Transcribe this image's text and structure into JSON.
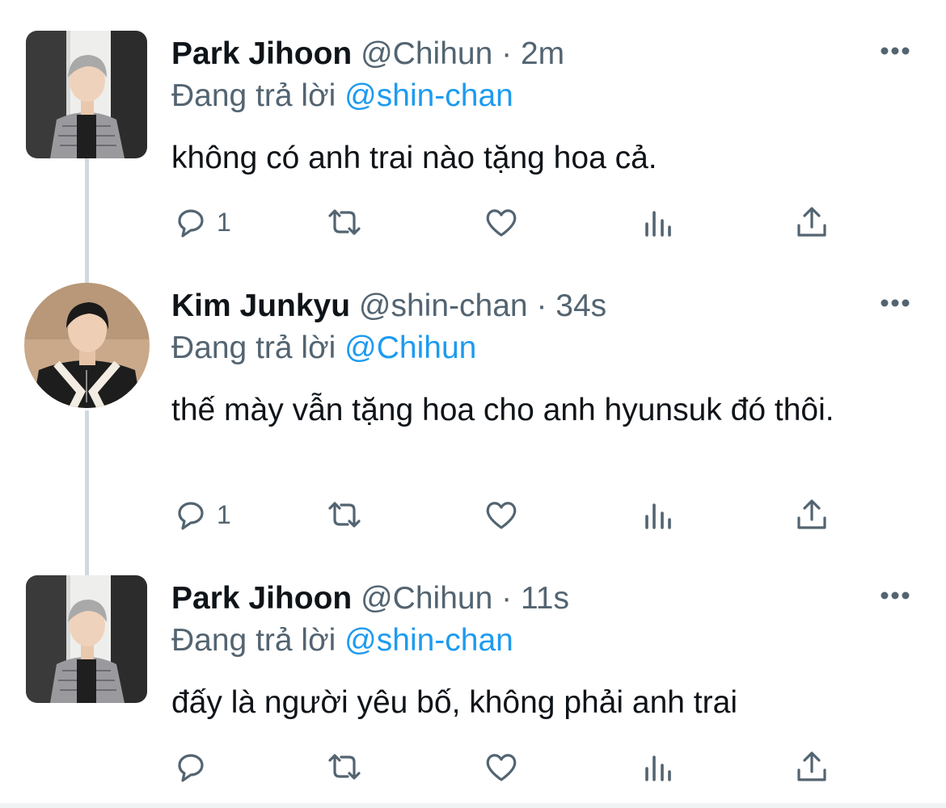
{
  "tweets": [
    {
      "name": "Park Jihoon",
      "handle": "@Chihun",
      "dot": "·",
      "time": "2m",
      "reply_prefix": "Đang trả lời",
      "reply_to": "@shin-chan",
      "text": "không có anh trai nào tặng hoa cả.",
      "reply_count": "1",
      "avatar": "profile-photo-grey-hair-tweed-jacket"
    },
    {
      "name": "Kim Junkyu",
      "handle": "@shin-chan",
      "dot": "·",
      "time": "34s",
      "reply_prefix": "Đang trả lời",
      "reply_to": "@Chihun",
      "text": "thế mày vẫn tặng hoa cho anh hyunsuk đó thôi.",
      "reply_count": "1",
      "avatar": "profile-photo-dark-hair-black-jacket"
    },
    {
      "name": "Park Jihoon",
      "handle": "@Chihun",
      "dot": "·",
      "time": "11s",
      "reply_prefix": "Đang trả lời",
      "reply_to": "@shin-chan",
      "text": "đấy là người yêu bố, không phải anh trai",
      "reply_count": "",
      "avatar": "profile-photo-grey-hair-tweed-jacket"
    }
  ],
  "icons": {
    "reply": "reply-icon",
    "retweet": "retweet-icon",
    "like": "heart-icon",
    "analytics": "analytics-icon",
    "share": "share-icon",
    "more": "more-dots-icon"
  },
  "colors": {
    "name": "#0f1419",
    "secondary": "#536471",
    "mention": "#1d9bf0",
    "thread_line": "#cfd9de"
  }
}
